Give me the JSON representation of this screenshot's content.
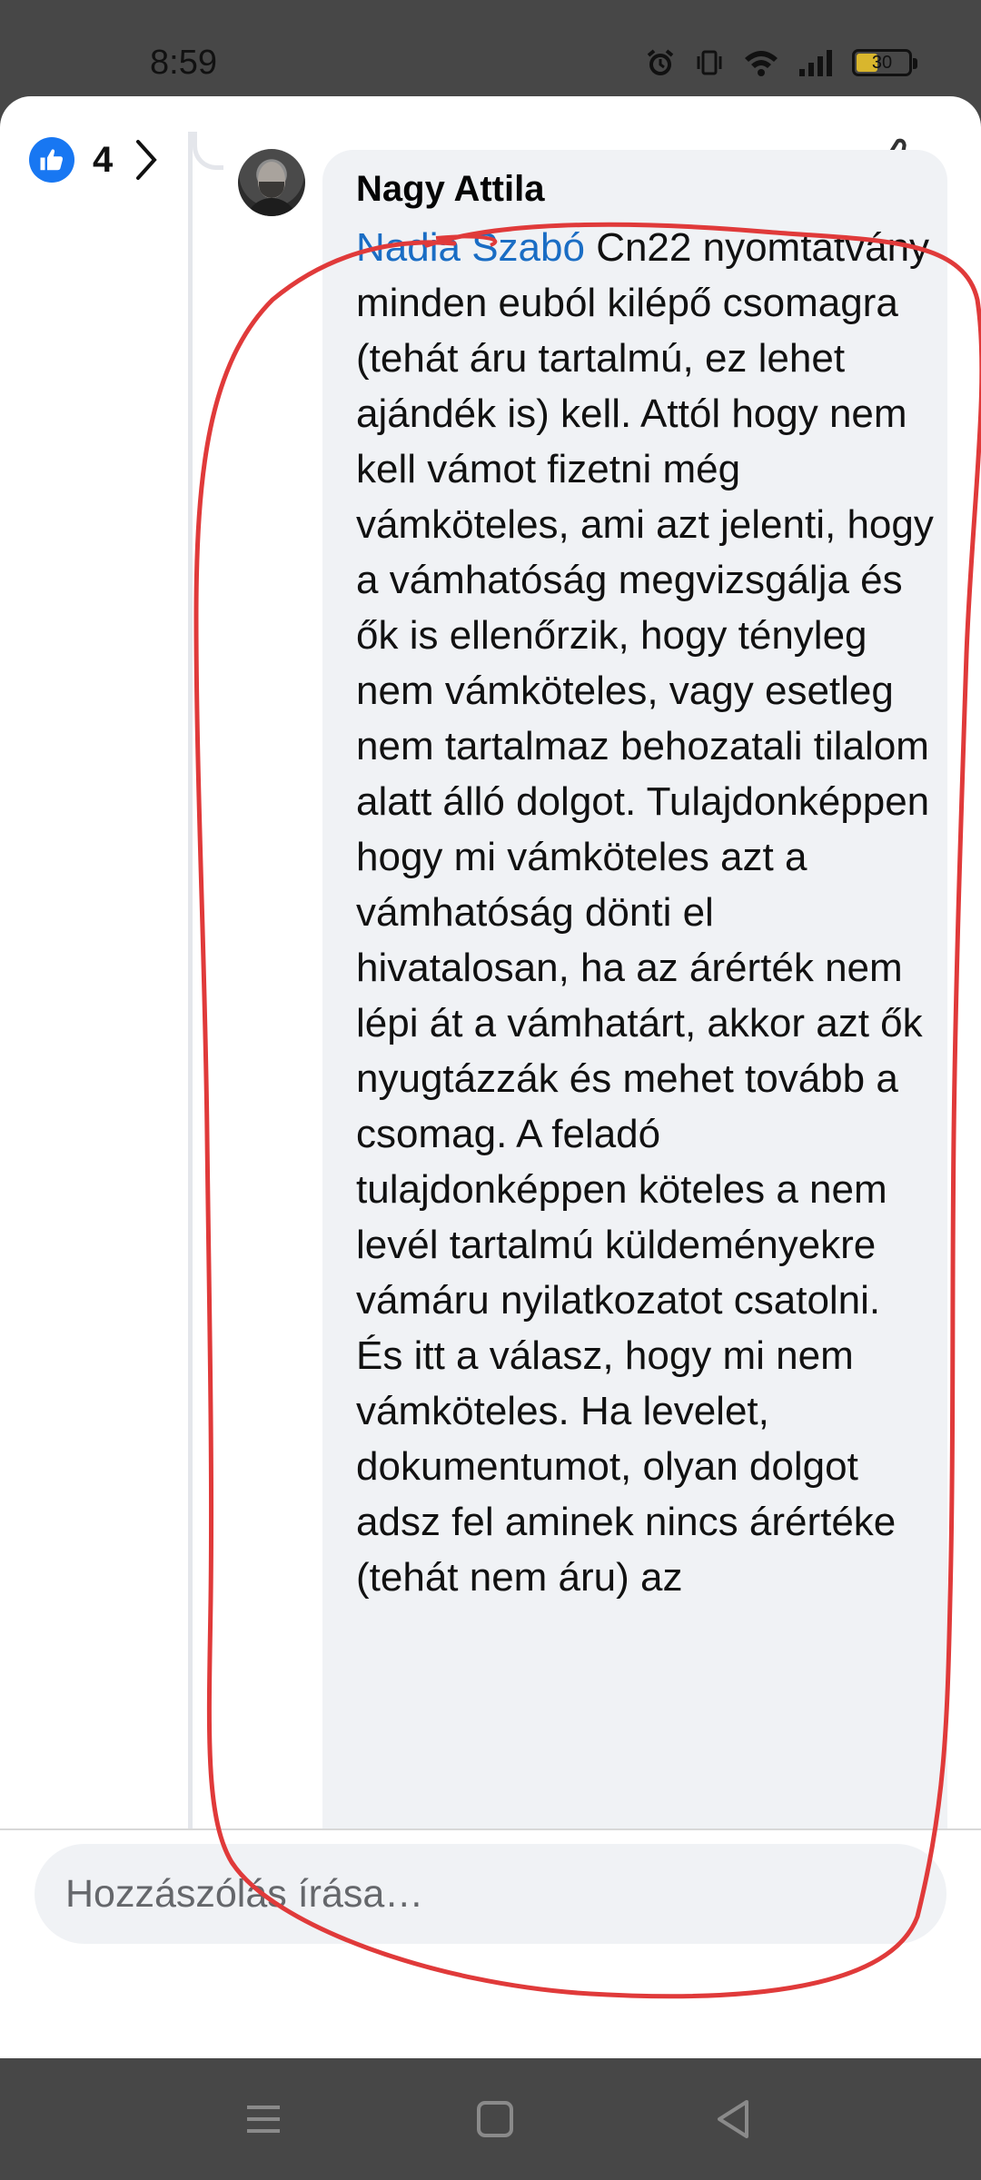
{
  "status_bar": {
    "time": "8:59",
    "battery_level": "30",
    "icons": [
      "alarm-icon",
      "vibrate-icon",
      "wifi-icon",
      "signal-icon",
      "battery-icon"
    ]
  },
  "reactions": {
    "icon": "like-icon",
    "count": "4",
    "accent": "#1877f2"
  },
  "comment": {
    "author": "Nagy Attila",
    "mention": "Nadia Szabó",
    "text": "Cn22 nyomtatvány minden euból kilépő csomagra (tehát áru tartalmú, ez lehet ajándék is) kell. Attól hogy nem kell vámot fizetni még vámköteles, ami azt jelenti, hogy a vámhatóság megvizsgálja és ők is ellenőrzik, hogy tényleg nem vámköteles, vagy esetleg nem tartalmaz behozatali tilalom alatt álló dolgot. Tulajdonképpen hogy mi vámköteles azt a vámhatóság dönti el hivatalosan, ha az árérték nem lépi át a vámhatárt, akkor azt ők nyugtázzák és mehet tovább a csomag. A feladó tulajdonképpen köteles a nem levél tartalmú küldeményekre vámáru nyilatkozatot csatolni. És itt a válasz, hogy mi nem vámköteles. Ha levelet, dokumentumot, olyan dolgot adsz fel aminek nincs árértéke (tehát nem áru) az",
    "mention_color": "#1a6dc4"
  },
  "composer": {
    "placeholder": "Hozzászólás írása…"
  },
  "annotation_color": "#e03a3a",
  "nav": [
    "menu-icon",
    "home-icon",
    "back-icon"
  ]
}
